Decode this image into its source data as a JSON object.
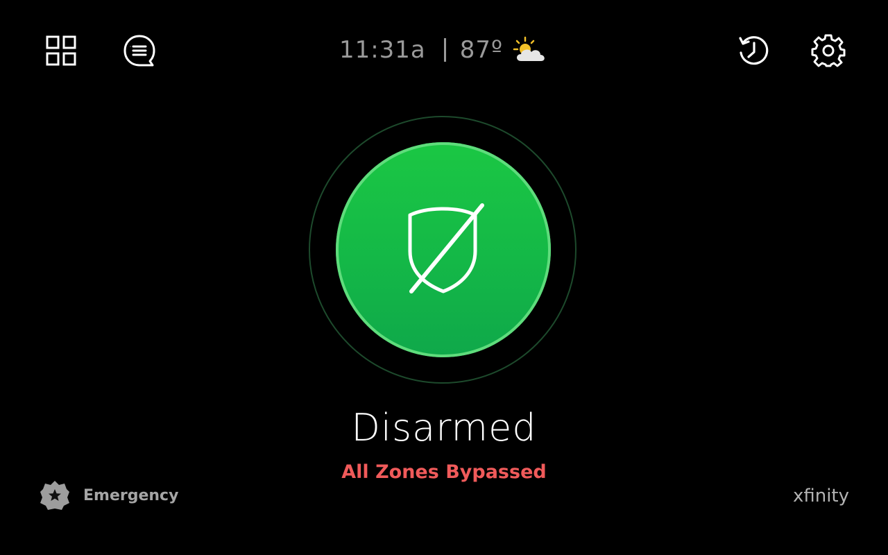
{
  "header": {
    "time": "11:31a",
    "temperature": "87º",
    "weather_icon": "partly-sunny-icon",
    "left_icons": [
      "apps-grid-icon",
      "messages-icon"
    ],
    "right_icons": [
      "history-icon",
      "gear-icon"
    ]
  },
  "arm_control": {
    "icon": "shield-off-icon",
    "status": "Disarmed",
    "substatus": "All Zones Bypassed",
    "status_color": "#1bc744",
    "substatus_color": "#f05a5a"
  },
  "emergency": {
    "label": "Emergency",
    "icon": "police-badge-icon"
  },
  "brand": {
    "logo_text": "xfinity"
  }
}
